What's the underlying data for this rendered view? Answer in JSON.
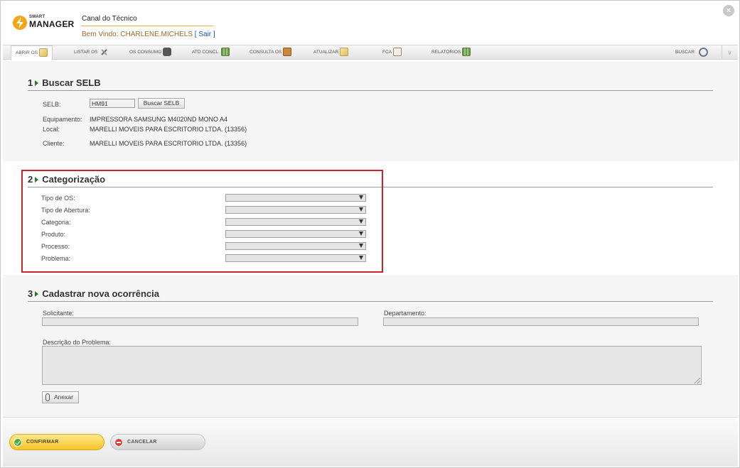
{
  "header": {
    "logo_small": "SMART",
    "logo_main": "MANAGER",
    "app_title": "Canal do Técnico",
    "welcome_prefix": "Bem Vindo: ",
    "user_name": "CHARLENE.MICHELS",
    "exit_link": "[ Sair ]",
    "close_icon": "×"
  },
  "nav": {
    "items": [
      {
        "label": "ABRIR OS",
        "icon": "edit-icon"
      },
      {
        "label": "LISTAR OS",
        "icon": "tools-icon"
      },
      {
        "label": "OS CONSUMO",
        "icon": "truck-icon"
      },
      {
        "label": "ATD CONCL.",
        "icon": "grid-icon"
      },
      {
        "label": "CONSULTA OS",
        "icon": "box-icon"
      },
      {
        "label": "ATUALIZAR",
        "icon": "edit-icon"
      },
      {
        "label": "FCA",
        "icon": "clipboard-icon"
      },
      {
        "label": "RELATORIOS",
        "icon": "grid-icon"
      }
    ],
    "search_label": "BUSCAR",
    "chevron": "∨"
  },
  "section1": {
    "number": "1",
    "title": "Buscar SELB",
    "selb_label": "SELB:",
    "selb_value": "HM91",
    "search_button": "Buscar SELB",
    "equipment_label": "Equipamento:",
    "equipment_value": "IMPRESSORA SAMSUNG M4020ND MONO A4",
    "location_label": "Local:",
    "location_value": "MARELLI MOVEIS PARA ESCRITORIO LTDA. (13356)",
    "client_label": "Cliente:",
    "client_value": "MARELLI MOVEIS PARA ESCRITORIO LTDA. (13356)"
  },
  "section2": {
    "number": "2",
    "title": "Categorização",
    "fields": [
      {
        "label": "Tipo de OS:",
        "value": ""
      },
      {
        "label": "Tipo de Abertura:",
        "value": ""
      },
      {
        "label": "Categoria:",
        "value": ""
      },
      {
        "label": "Produto:",
        "value": ""
      },
      {
        "label": "Processo:",
        "value": ""
      },
      {
        "label": "Problema:",
        "value": ""
      }
    ]
  },
  "section3": {
    "number": "3",
    "title": "Cadastrar nova ocorrência",
    "requester_label": "Solicitante:",
    "department_label": "Departamento:",
    "description_label": "Descrição do Problema:",
    "attach_button": "Anexar"
  },
  "footer": {
    "confirm_button": "CONFIRMAR",
    "cancel_button": "CANCELAR"
  },
  "colors": {
    "highlight": "#d0202a",
    "accent": "#f4c22c",
    "section_arrow": "#2a7a2a"
  }
}
